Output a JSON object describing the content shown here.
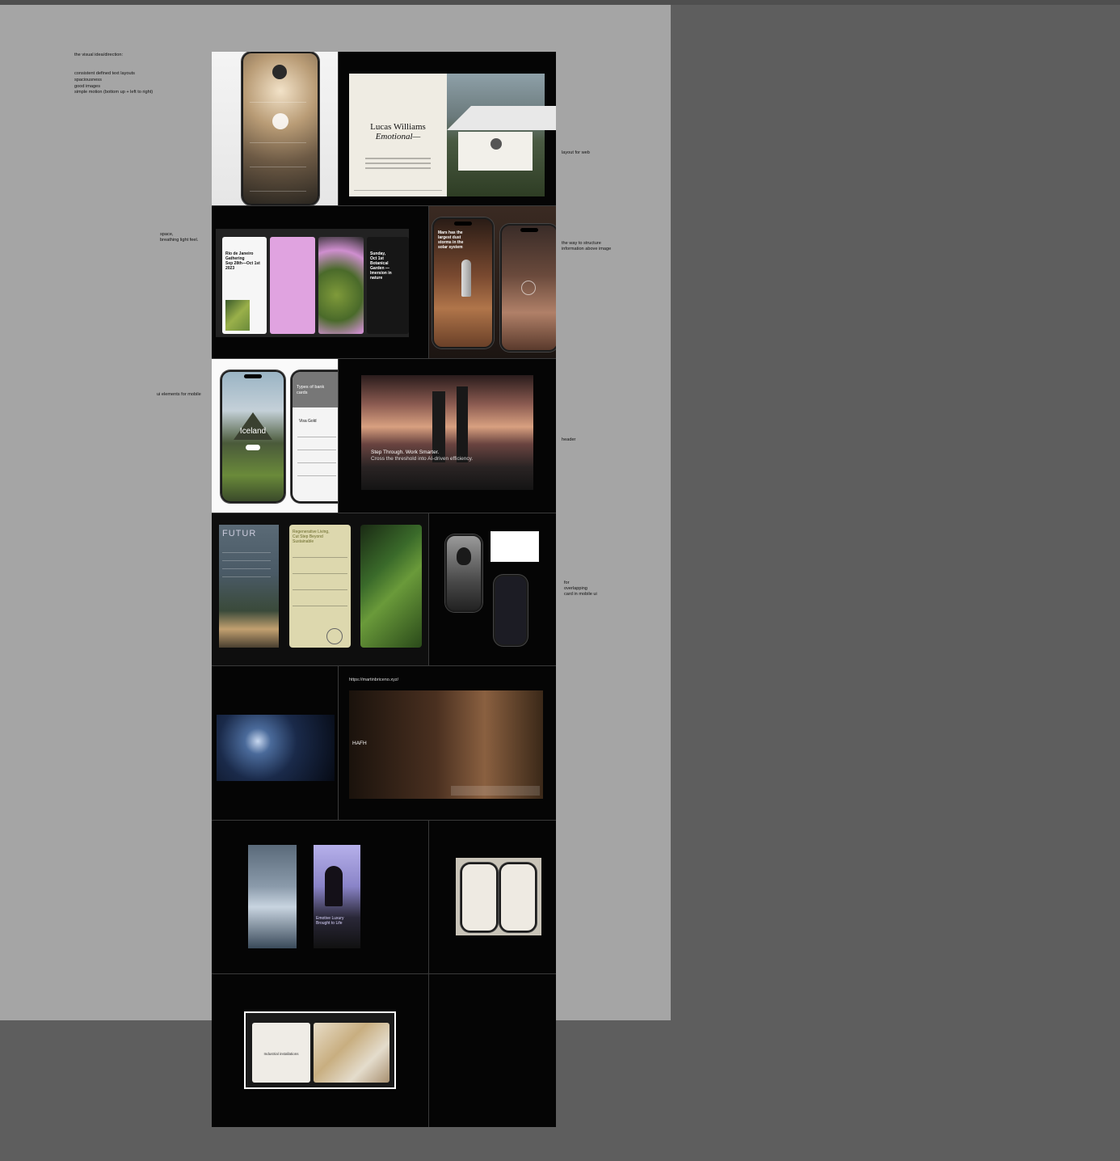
{
  "notes": {
    "intro": "the visual idea/direction:",
    "list": [
      "consistent defined text layouts",
      "spaciousness",
      "good images",
      "simple motion (bottom up + left to right)"
    ],
    "layout_web": "layout for web",
    "space": "space,\nbreathing light feel.",
    "structure": "the way to structure\ninformation above image",
    "ui_mobile": "ui elements for mobile",
    "header": "header",
    "overlapping": "for\noverlapping\ncard in mobile ui"
  },
  "cards": {
    "lucas_title": "Lucas Williams",
    "lucas_sub": "Emotional—",
    "rio": "Rio de Janeiro\nGathering\nSep 28th—Oct 1st\n2023",
    "botanical": "Sunday,\nOct 1st\nBotanical\nGarden —\nImersion in\nnature",
    "mars": "Mars has the\nlargest dust\nstorms in the\nsolar system",
    "iceland": "Iceland",
    "bank": "Types of bank\ncards",
    "bank_tier": "Visa Gold",
    "header_h1": "Step Through. Work Smarter.",
    "header_h2": "Cross the threshold into AI-driven efficiency.",
    "futur": "FUTUR",
    "regen": "Regenerative Living,\nCut Step Beyond\nSustainable",
    "url": "https://martinbriceno.xyz/",
    "hafh": "HAFH",
    "emotive": "Emotive Luxury\nBrought to Life",
    "industrial": "Industrial installations"
  },
  "colors": {
    "canvas": "#a5a5a5",
    "outer": "#5e5e5e",
    "board": "#050505",
    "pink": "#e0a3e0",
    "khaki": "#ddd8ae"
  }
}
